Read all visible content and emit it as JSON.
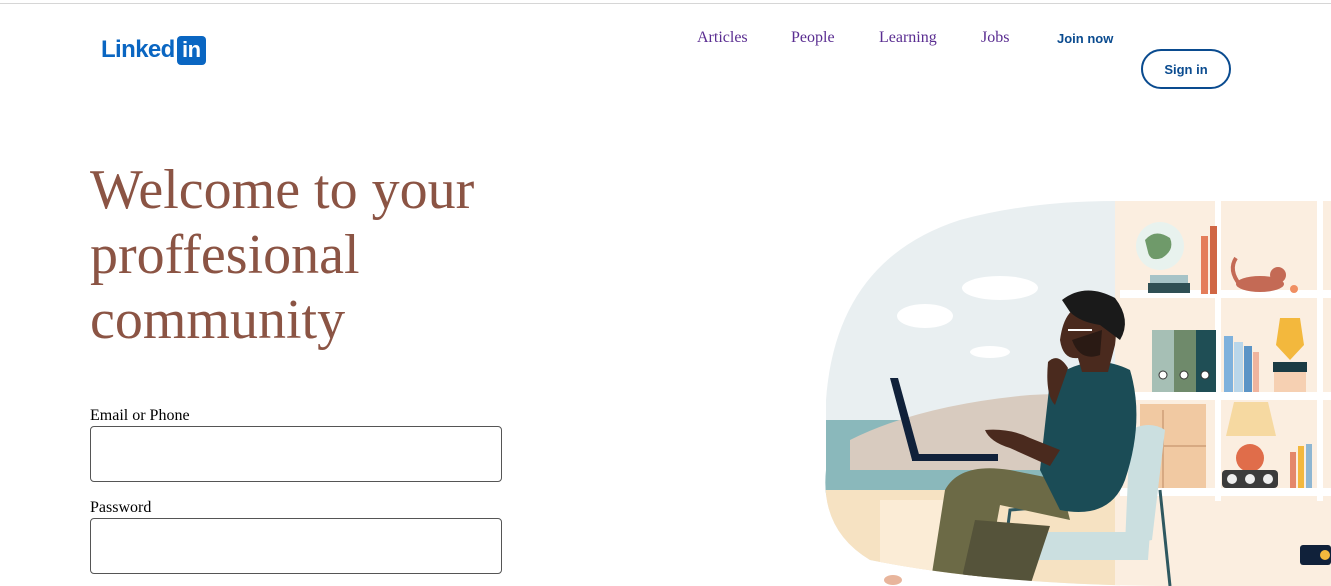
{
  "brand": {
    "logo_word": "Linked",
    "logo_box": "in"
  },
  "nav": {
    "links": [
      {
        "label": "Articles"
      },
      {
        "label": "People"
      },
      {
        "label": "Learning"
      },
      {
        "label": "Jobs"
      }
    ],
    "join_label": "Join now",
    "signin_label": "Sign in"
  },
  "hero": {
    "headline_lines": [
      "Welcome to your",
      "proffesional",
      "community"
    ]
  },
  "form": {
    "email_label": "Email or Phone",
    "email_value": "",
    "password_label": "Password",
    "password_value": ""
  },
  "colors": {
    "brand_blue": "#0a66c2",
    "nav_purple": "#5a2d91",
    "headline_brown": "#8b5444",
    "button_blue": "#0a4b8f"
  }
}
